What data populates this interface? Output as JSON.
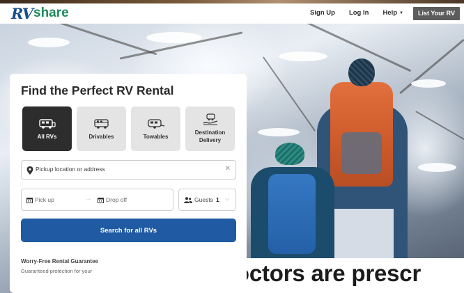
{
  "header": {
    "logo": {
      "rv": "RV",
      "share": "share"
    },
    "nav": {
      "sign_up": "Sign Up",
      "log_in": "Log In",
      "help": "Help",
      "list_your_rv": "List Your RV"
    }
  },
  "search_card": {
    "title": "Find the Perfect RV Rental",
    "types": [
      {
        "label": "All RVs",
        "icon": "all-rvs-icon",
        "selected": true
      },
      {
        "label": "Drivables",
        "icon": "motorhome-icon",
        "selected": false
      },
      {
        "label": "Towables",
        "icon": "trailer-icon",
        "selected": false
      },
      {
        "label": "Destination Delivery",
        "icon": "delivery-icon",
        "selected": false
      }
    ],
    "location": {
      "placeholder": "Pickup location or address"
    },
    "dates": {
      "pickup": "Pick up",
      "dropoff": "Drop off"
    },
    "guests": {
      "label": "Guests",
      "count": "1"
    },
    "search_button": "Search for all RVs",
    "guarantee": {
      "title": "Worry-Free Rental Guarantee",
      "text": "Guaranteed protection for your"
    }
  },
  "caption": "Canadian doctors are prescr",
  "colors": {
    "brand_blue": "#1f5aa3",
    "logo_blue": "#1a4e8c",
    "logo_green": "#1d8a5c",
    "selected_type": "#2d2d2d"
  }
}
